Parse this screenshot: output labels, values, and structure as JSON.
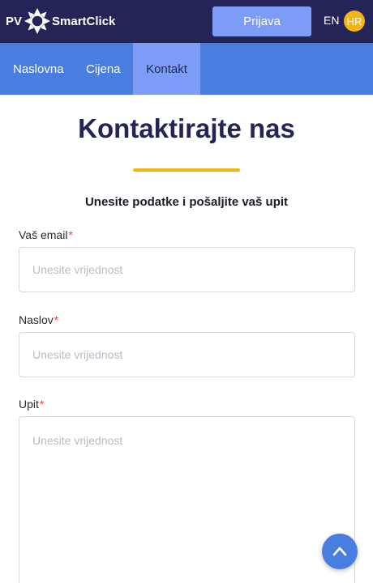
{
  "header": {
    "logo_prefix": "PV",
    "logo_name": "SmartClick",
    "login_label": "Prijava",
    "lang_en": "EN",
    "lang_hr": "HR"
  },
  "nav": {
    "items": [
      {
        "label": "Naslovna"
      },
      {
        "label": "Cijena"
      },
      {
        "label": "Kontakt",
        "active": true
      }
    ]
  },
  "main": {
    "title": "Kontaktirajte nas",
    "subtitle": "Unesite podatke i pošaljite vaš upit",
    "fields": [
      {
        "label": "Vaš email",
        "required_mark": "*",
        "placeholder": "Unesite vrijednost",
        "value": ""
      },
      {
        "label": "Naslov",
        "required_mark": "*",
        "placeholder": "Unesite vrijednost",
        "value": ""
      },
      {
        "label": "Upit",
        "required_mark": "*",
        "placeholder": "Unesite vrijednost",
        "value": ""
      }
    ]
  },
  "colors": {
    "header_bg": "#252457",
    "nav_bg": "#4a7de0",
    "nav_active_bg": "#7c9cf7",
    "accent_yellow": "#f5b416",
    "required_red": "#e0453a"
  },
  "icons": {
    "logo": "sun-icon",
    "scroll_top": "chevron-up-icon"
  }
}
